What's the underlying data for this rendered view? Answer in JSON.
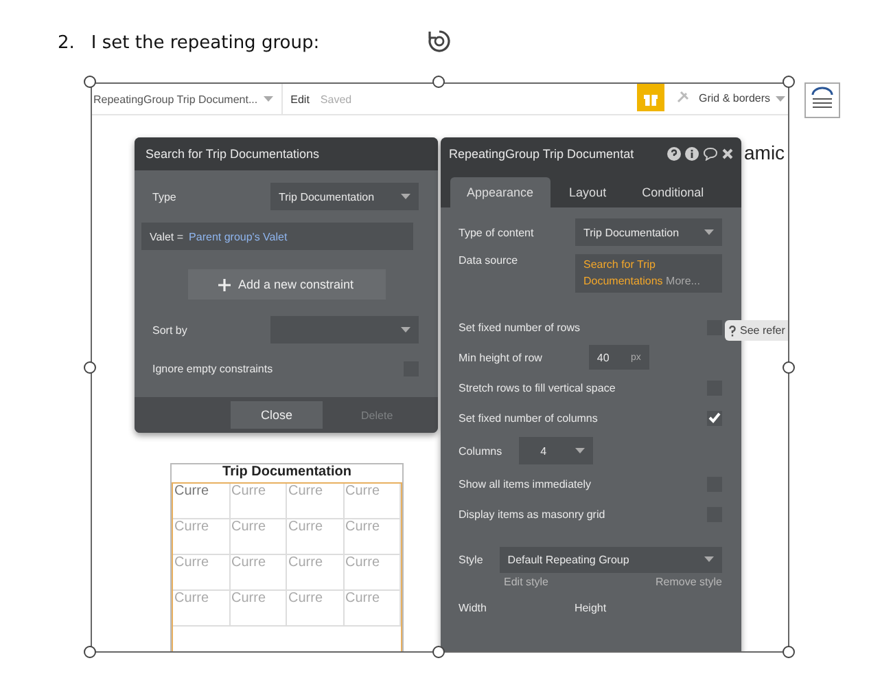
{
  "document": {
    "number": "2.",
    "heading": "I set the repeating group:"
  },
  "editor": {
    "element_dropdown": "RepeatingGroup Trip Document...",
    "edit": "Edit",
    "saved": "Saved",
    "grid_menu": "Grid & borders",
    "fragments": [
      "amic"
    ],
    "tooltip": "See refer"
  },
  "search_panel": {
    "title": "Search for Trip Documentations",
    "type_label": "Type",
    "type_value": "Trip Documentation",
    "constraint": {
      "field": "Valet =",
      "value": "Parent group's Valet"
    },
    "add_button": "Add a new constraint",
    "sort_label": "Sort by",
    "ignore_label": "Ignore empty constraints",
    "ignore_checked": false,
    "close": "Close",
    "delete": {
      "label": "Delete",
      "disabled": true
    }
  },
  "property_panel": {
    "title": "RepeatingGroup Trip Documentat",
    "tabs": [
      {
        "label": "Appearance",
        "selected": true
      },
      {
        "label": "Layout",
        "selected": false
      },
      {
        "label": "Conditional",
        "selected": false
      }
    ],
    "type_label": "Type of content",
    "type_value": "Trip Documentation",
    "source_label": "Data source",
    "source_value": "Search for Trip Documentations",
    "source_more": "More...",
    "rows": [
      {
        "kind": "checkbox",
        "label": "Set fixed number of rows",
        "checked": false
      },
      {
        "kind": "number",
        "label": "Min height of row",
        "value": "40",
        "unit": "px"
      },
      {
        "kind": "checkbox",
        "label": "Stretch rows to fill vertical space",
        "checked": false
      },
      {
        "kind": "checkbox",
        "label": "Set fixed number of columns",
        "checked": true
      },
      {
        "kind": "select",
        "label": "Columns",
        "value": "4"
      },
      {
        "kind": "checkbox",
        "label": "Show all items immediately",
        "checked": false
      },
      {
        "kind": "checkbox",
        "label": "Display items as masonry grid",
        "checked": false
      }
    ],
    "style_label": "Style",
    "style_value": "Default Repeating Group",
    "edit_style": "Edit style",
    "remove_style": "Remove style",
    "width_label": "Width",
    "height_label": "Height"
  },
  "repeating_group": {
    "title": "Trip Documentation",
    "cells": [
      "Curre",
      "Curre",
      "Curre",
      "Curre",
      "Curre",
      "Curre",
      "Curre",
      "Curre",
      "Curre",
      "Curre",
      "Curre",
      "Curre",
      "Curre",
      "Curre",
      "Curre",
      "Curre"
    ]
  }
}
